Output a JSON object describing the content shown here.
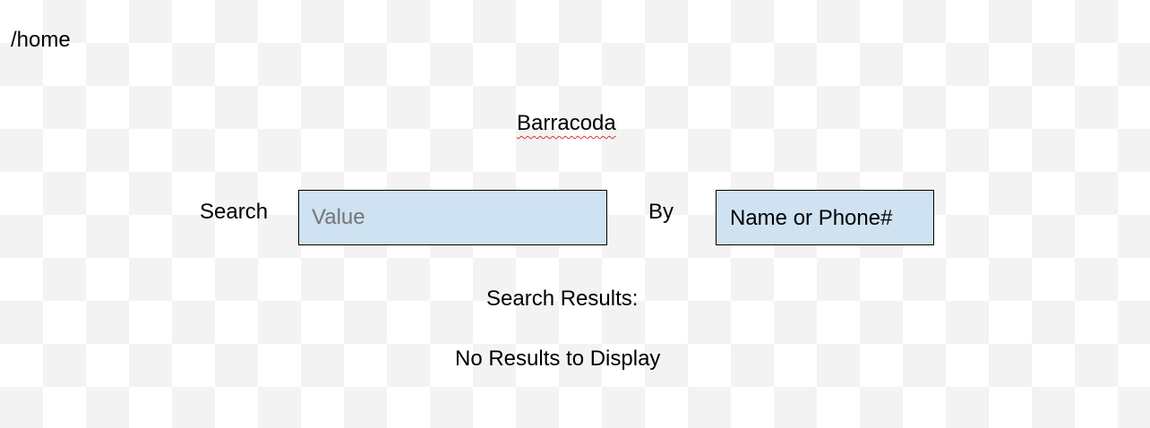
{
  "location": "/home",
  "app": {
    "title": "Barracoda"
  },
  "search": {
    "label": "Search",
    "value_placeholder": "Value",
    "by_label": "By",
    "by_selected": "Name or Phone#"
  },
  "results": {
    "heading": "Search Results:",
    "empty_message": "No Results to Display"
  },
  "colors": {
    "field_background": "#cfe2f1",
    "spellcheck_underline": "#e0312c"
  }
}
